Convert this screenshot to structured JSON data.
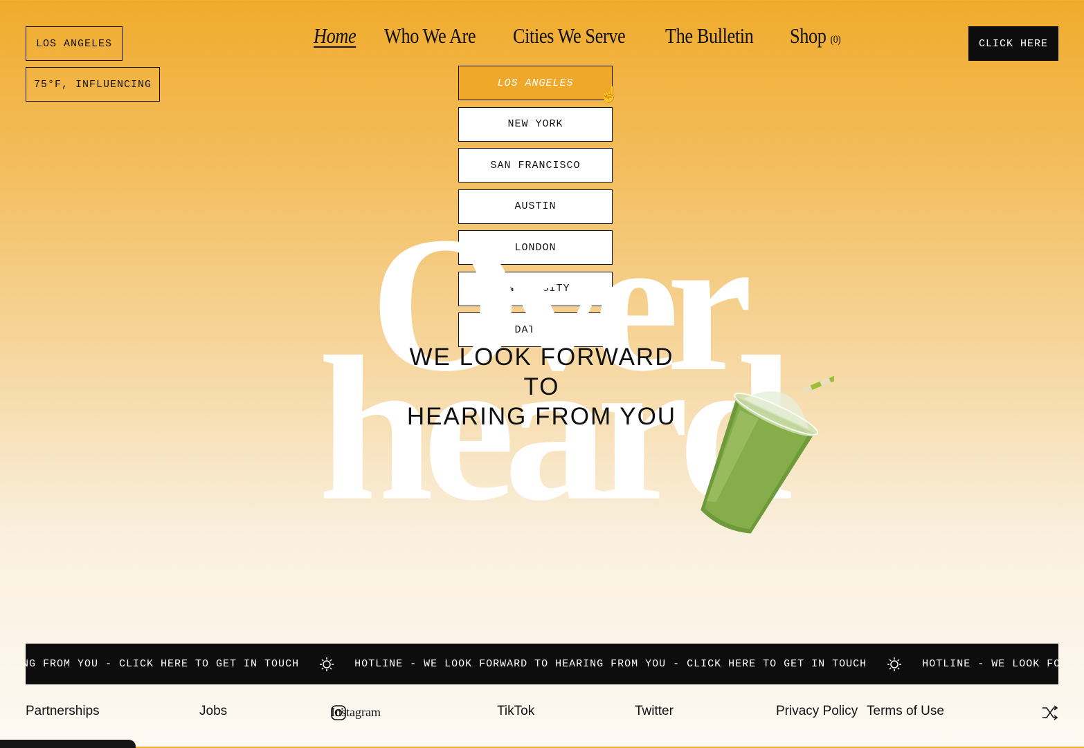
{
  "header": {
    "city": "LOS ANGELES",
    "weather": "75°F, INFLUENCING",
    "cta": "CLICK HERE"
  },
  "nav": {
    "home": "Home",
    "who": "Who We Are",
    "cities": "Cities We Serve",
    "bulletin": "The Bulletin",
    "shop": "Shop",
    "shop_count": "(0)"
  },
  "dropdown": {
    "items": [
      "LOS ANGELES",
      "NEW YORK",
      "SAN FRANCISCO",
      "AUSTIN",
      "LONDON",
      "UNIVERSITY",
      "DATING"
    ],
    "selected": "LOS ANGELES"
  },
  "hero": {
    "word1": "Over",
    "word2": "heard",
    "headline_line1": "WE LOOK FORWARD TO",
    "headline_line2": "HEARING FROM YOU"
  },
  "ticker": {
    "segment_a": "HEARING FROM YOU - CLICK HERE TO GET IN TOUCH",
    "segment_b": "HOTLINE - WE LOOK FORWARD TO HEARING FROM YOU - CLICK HERE TO GET IN TOUCH",
    "segment_c": "HOTLINE - WE LOOK FORWARD TO HEARING"
  },
  "footer": {
    "partnerships": "Partnerships",
    "jobs": "Jobs",
    "instagram": "Instagram",
    "tiktok": "TikTok",
    "twitter": "Twitter",
    "privacy": "Privacy Policy",
    "terms": "Terms of Use"
  },
  "colors": {
    "accent": "#f0a82a",
    "dark": "#0d0d0d"
  }
}
